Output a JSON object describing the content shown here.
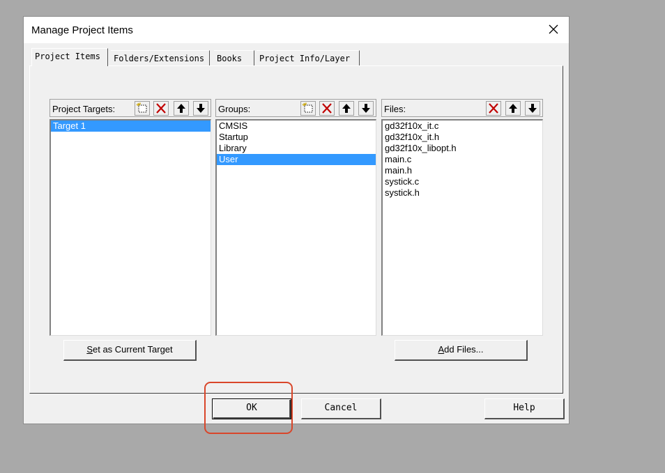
{
  "window": {
    "title": "Manage Project Items"
  },
  "tabs": [
    {
      "label": "Project Items"
    },
    {
      "label": "Folders/Extensions"
    },
    {
      "label": "Books"
    },
    {
      "label": "Project Info/Layer"
    }
  ],
  "targets": {
    "header": "Project Targets:",
    "items": [
      "Target 1"
    ],
    "selected": "Target 1",
    "button_accel": "S",
    "button_rest": "et as Current Target"
  },
  "groups": {
    "header": "Groups:",
    "items": [
      "CMSIS",
      "Startup",
      "Library",
      "User"
    ],
    "selected": "User"
  },
  "files": {
    "header": "Files:",
    "items": [
      "gd32f10x_it.c",
      "gd32f10x_it.h",
      "gd32f10x_libopt.h",
      "main.c",
      "main.h",
      "systick.c",
      "systick.h"
    ],
    "button_accel": "A",
    "button_rest": "dd Files..."
  },
  "footer": {
    "ok": "OK",
    "cancel": "Cancel",
    "help": "Help"
  },
  "icons": {
    "new": "new-item-icon",
    "delete": "delete-x-icon",
    "up": "arrow-up-icon",
    "down": "arrow-down-icon",
    "close": "close-icon"
  },
  "colors": {
    "selection": "#3399ff",
    "highlight_box": "#d9462a"
  }
}
